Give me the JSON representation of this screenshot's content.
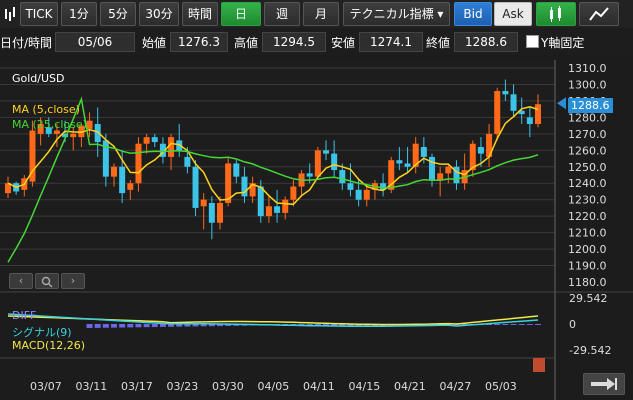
{
  "toolbar": {
    "tick": "TICK",
    "m1": "1分",
    "m5": "5分",
    "m30": "30分",
    "hour": "時間",
    "day": "日",
    "week": "週",
    "month": "月",
    "indicator": "テクニカル指標 ▾",
    "bid": "Bid",
    "ask": "Ask"
  },
  "ohlc": {
    "datetime_label": "日付/時間",
    "date": "05/06",
    "open_label": "始値",
    "open": "1276.3",
    "high_label": "高値",
    "high": "1294.5",
    "low_label": "安値",
    "low": "1274.1",
    "close_label": "終値",
    "close": "1288.6",
    "yfix_label": "Y軸固定"
  },
  "chart": {
    "symbol": "Gold/USD",
    "ma5_label": "MA (5,close)",
    "ma25_label": "MA (25,close)",
    "current_price": "1288.6",
    "colors": {
      "up": "#ff6a1a",
      "down": "#3cc3e8",
      "ma5": "#ffd21a",
      "ma25": "#46d637",
      "diff": "#4fb7e8",
      "signal": "#3ad3e0",
      "macd": "#f1e84a",
      "hist": "#6b67e6",
      "price_tag": "#2a8fd6"
    }
  },
  "macd": {
    "diff_label": "DIFF",
    "signal_label": "シグナル(9)",
    "macd_label": "MACD(12,26)",
    "ticks": [
      "29.542",
      "0",
      "-29.542"
    ]
  },
  "chart_data": {
    "type": "candlestick",
    "y_ticks": [
      "1310.0",
      "1300.0",
      "1290.0",
      "1280.0",
      "1270.0",
      "1260.0",
      "1250.0",
      "1240.0",
      "1230.0",
      "1220.0",
      "1210.0",
      "1200.0",
      "1190.0",
      "1180.0"
    ],
    "ylim": [
      1180,
      1310
    ],
    "x_labels": [
      "03/07",
      "03/11",
      "03/17",
      "03/23",
      "03/30",
      "04/05",
      "04/11",
      "04/15",
      "04/21",
      "04/27",
      "05/03"
    ],
    "candles": [
      [
        1234,
        1244,
        1231,
        1240
      ],
      [
        1240,
        1241,
        1233,
        1235
      ],
      [
        1236,
        1245,
        1232,
        1243
      ],
      [
        1241,
        1278,
        1238,
        1272
      ],
      [
        1270,
        1280,
        1263,
        1276
      ],
      [
        1274,
        1280,
        1268,
        1270
      ],
      [
        1270,
        1276,
        1262,
        1272
      ],
      [
        1270,
        1278,
        1265,
        1268
      ],
      [
        1268,
        1274,
        1260,
        1270
      ],
      [
        1268,
        1276,
        1262,
        1275
      ],
      [
        1273,
        1283,
        1268,
        1278
      ],
      [
        1276,
        1286,
        1256,
        1265
      ],
      [
        1266,
        1270,
        1238,
        1244
      ],
      [
        1244,
        1252,
        1238,
        1250
      ],
      [
        1250,
        1260,
        1228,
        1234
      ],
      [
        1236,
        1242,
        1230,
        1240
      ],
      [
        1240,
        1268,
        1235,
        1264
      ],
      [
        1264,
        1270,
        1258,
        1268
      ],
      [
        1268,
        1270,
        1262,
        1265
      ],
      [
        1264,
        1268,
        1252,
        1256
      ],
      [
        1256,
        1270,
        1248,
        1268
      ],
      [
        1266,
        1276,
        1256,
        1260
      ],
      [
        1256,
        1262,
        1246,
        1250
      ],
      [
        1250,
        1254,
        1220,
        1225
      ],
      [
        1226,
        1234,
        1212,
        1230
      ],
      [
        1228,
        1232,
        1206,
        1216
      ],
      [
        1216,
        1232,
        1212,
        1228
      ],
      [
        1228,
        1256,
        1226,
        1252
      ],
      [
        1252,
        1254,
        1240,
        1244
      ],
      [
        1244,
        1250,
        1228,
        1232
      ],
      [
        1232,
        1244,
        1228,
        1240
      ],
      [
        1238,
        1242,
        1216,
        1220
      ],
      [
        1220,
        1232,
        1216,
        1226
      ],
      [
        1226,
        1236,
        1216,
        1222
      ],
      [
        1222,
        1232,
        1218,
        1230
      ],
      [
        1230,
        1242,
        1226,
        1238
      ],
      [
        1238,
        1248,
        1232,
        1246
      ],
      [
        1246,
        1252,
        1240,
        1244
      ],
      [
        1244,
        1262,
        1242,
        1260
      ],
      [
        1260,
        1266,
        1254,
        1258
      ],
      [
        1258,
        1266,
        1244,
        1248
      ],
      [
        1248,
        1252,
        1236,
        1240
      ],
      [
        1240,
        1252,
        1232,
        1236
      ],
      [
        1236,
        1242,
        1226,
        1230
      ],
      [
        1230,
        1238,
        1226,
        1236
      ],
      [
        1236,
        1242,
        1230,
        1240
      ],
      [
        1240,
        1246,
        1232,
        1236
      ],
      [
        1236,
        1256,
        1234,
        1254
      ],
      [
        1254,
        1262,
        1248,
        1252
      ],
      [
        1252,
        1262,
        1246,
        1250
      ],
      [
        1250,
        1268,
        1246,
        1264
      ],
      [
        1262,
        1268,
        1252,
        1256
      ],
      [
        1256,
        1258,
        1238,
        1242
      ],
      [
        1242,
        1250,
        1232,
        1246
      ],
      [
        1246,
        1252,
        1240,
        1250
      ],
      [
        1250,
        1254,
        1236,
        1240
      ],
      [
        1240,
        1258,
        1236,
        1248
      ],
      [
        1248,
        1266,
        1244,
        1264
      ],
      [
        1262,
        1268,
        1250,
        1258
      ],
      [
        1256,
        1276,
        1250,
        1270
      ],
      [
        1270,
        1298,
        1266,
        1296
      ],
      [
        1296,
        1303,
        1290,
        1294
      ],
      [
        1294,
        1300,
        1280,
        1284
      ],
      [
        1284,
        1292,
        1276,
        1282
      ],
      [
        1280,
        1286,
        1268,
        1276
      ],
      [
        1276,
        1294,
        1274,
        1288
      ]
    ]
  }
}
